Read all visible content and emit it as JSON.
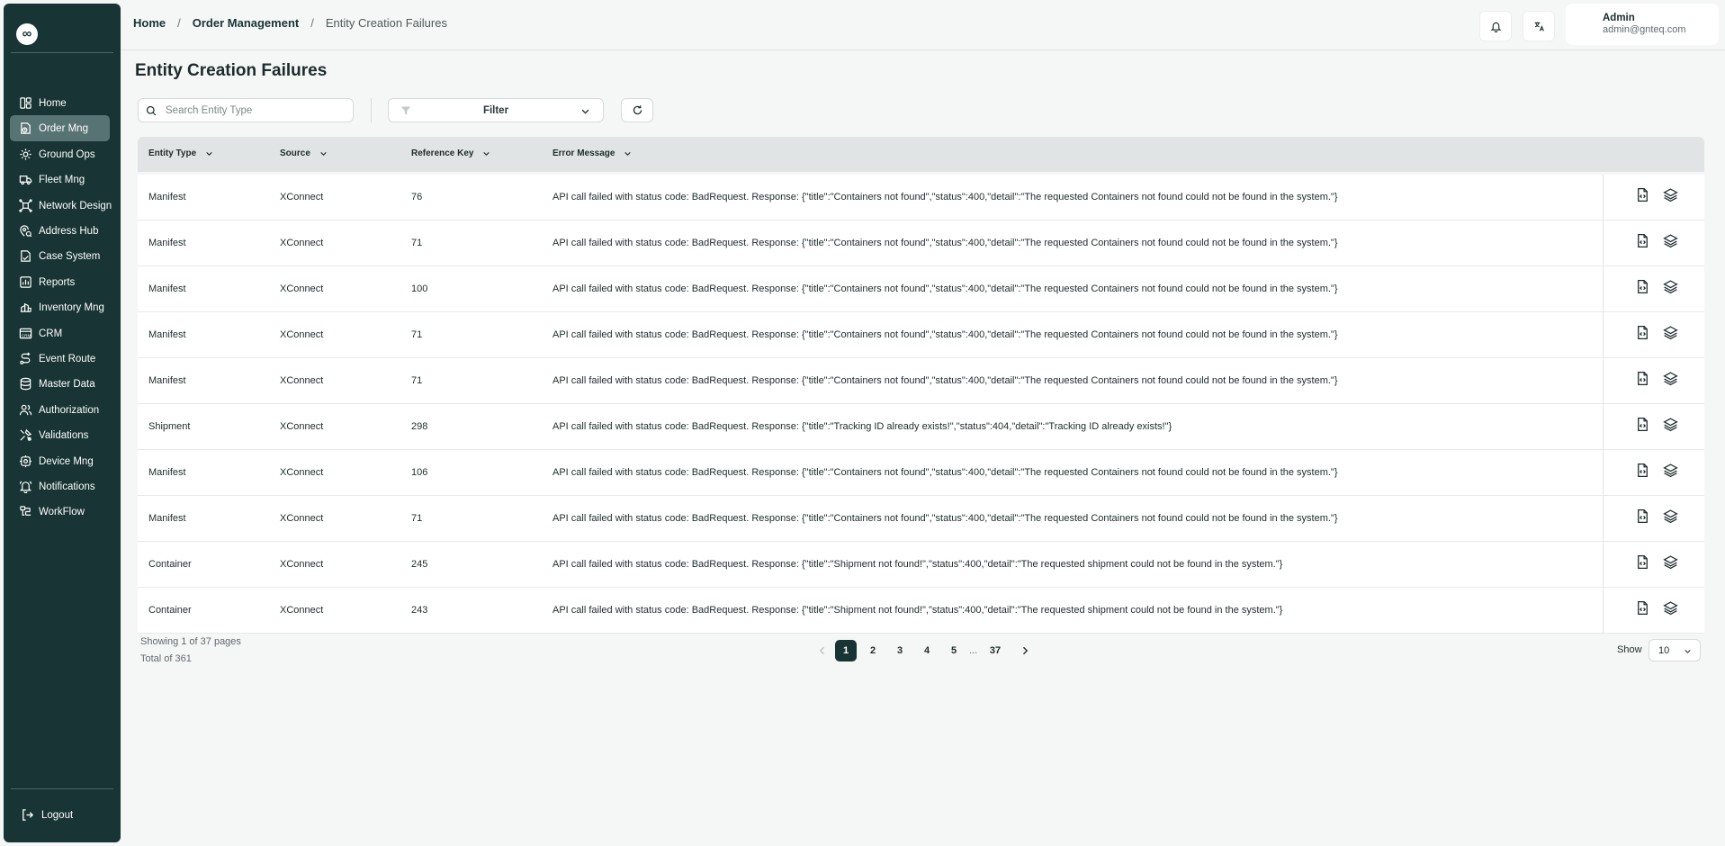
{
  "app": {
    "logo_glyph": "∞"
  },
  "sidebar": {
    "items": [
      {
        "label": "Home",
        "icon": "dashboard-icon"
      },
      {
        "label": "Order Mng",
        "icon": "order-icon",
        "active": true
      },
      {
        "label": "Ground Ops",
        "icon": "ground-ops-icon"
      },
      {
        "label": "Fleet Mng",
        "icon": "truck-icon"
      },
      {
        "label": "Network Design",
        "icon": "network-icon"
      },
      {
        "label": "Address Hub",
        "icon": "address-icon"
      },
      {
        "label": "Case System",
        "icon": "case-icon"
      },
      {
        "label": "Reports",
        "icon": "reports-icon"
      },
      {
        "label": "Inventory Mng",
        "icon": "inventory-icon"
      },
      {
        "label": "CRM",
        "icon": "crm-icon"
      },
      {
        "label": "Event Route",
        "icon": "route-icon"
      },
      {
        "label": "Master Data",
        "icon": "database-icon"
      },
      {
        "label": "Authorization",
        "icon": "users-icon"
      },
      {
        "label": "Validations",
        "icon": "validation-icon"
      },
      {
        "label": "Device Mng",
        "icon": "device-icon"
      },
      {
        "label": "Notifications",
        "icon": "bell-icon"
      },
      {
        "label": "WorkFlow",
        "icon": "workflow-icon"
      }
    ],
    "logout_label": "Logout"
  },
  "header": {
    "breadcrumb": {
      "home": "Home",
      "section": "Order Management",
      "current": "Entity Creation Failures"
    },
    "user": {
      "name": "Admin",
      "email": "admin@gnteq.com"
    }
  },
  "page": {
    "title": "Entity Creation Failures",
    "search_placeholder": "Search Entity Type",
    "filter_label": "Filter"
  },
  "table": {
    "columns": [
      "Entity Type",
      "Source",
      "Reference Key",
      "Error Message"
    ],
    "rows": [
      {
        "entity_type": "Manifest",
        "source": "XConnect",
        "reference_key": "76",
        "error_message": "API call failed with status code: BadRequest. Response: {\"title\":\"Containers not found\",\"status\":400,\"detail\":\"The requested Containers not found could not be found in the system.\"}"
      },
      {
        "entity_type": "Manifest",
        "source": "XConnect",
        "reference_key": "71",
        "error_message": "API call failed with status code: BadRequest. Response: {\"title\":\"Containers not found\",\"status\":400,\"detail\":\"The requested Containers not found could not be found in the system.\"}"
      },
      {
        "entity_type": "Manifest",
        "source": "XConnect",
        "reference_key": "100",
        "error_message": "API call failed with status code: BadRequest. Response: {\"title\":\"Containers not found\",\"status\":400,\"detail\":\"The requested Containers not found could not be found in the system.\"}"
      },
      {
        "entity_type": "Manifest",
        "source": "XConnect",
        "reference_key": "71",
        "error_message": "API call failed with status code: BadRequest. Response: {\"title\":\"Containers not found\",\"status\":400,\"detail\":\"The requested Containers not found could not be found in the system.\"}"
      },
      {
        "entity_type": "Manifest",
        "source": "XConnect",
        "reference_key": "71",
        "error_message": "API call failed with status code: BadRequest. Response: {\"title\":\"Containers not found\",\"status\":400,\"detail\":\"The requested Containers not found could not be found in the system.\"}"
      },
      {
        "entity_type": "Shipment",
        "source": "XConnect",
        "reference_key": "298",
        "error_message": "API call failed with status code: BadRequest. Response: {\"title\":\"Tracking ID already exists!\",\"status\":404,\"detail\":\"Tracking ID already exists!\"}"
      },
      {
        "entity_type": "Manifest",
        "source": "XConnect",
        "reference_key": "106",
        "error_message": "API call failed with status code: BadRequest. Response: {\"title\":\"Containers not found\",\"status\":400,\"detail\":\"The requested Containers not found could not be found in the system.\"}"
      },
      {
        "entity_type": "Manifest",
        "source": "XConnect",
        "reference_key": "71",
        "error_message": "API call failed with status code: BadRequest. Response: {\"title\":\"Containers not found\",\"status\":400,\"detail\":\"The requested Containers not found could not be found in the system.\"}"
      },
      {
        "entity_type": "Container",
        "source": "XConnect",
        "reference_key": "245",
        "error_message": "API call failed with status code: BadRequest. Response: {\"title\":\"Shipment not found!\",\"status\":400,\"detail\":\"The requested shipment could not be found in the system.\"}"
      },
      {
        "entity_type": "Container",
        "source": "XConnect",
        "reference_key": "243",
        "error_message": "API call failed with status code: BadRequest. Response: {\"title\":\"Shipment not found!\",\"status\":400,\"detail\":\"The requested shipment could not be found in the system.\"}"
      }
    ]
  },
  "pagination": {
    "showing_text": "Showing 1 of 37 pages",
    "total_text": "Total of 361",
    "pages": [
      "1",
      "2",
      "3",
      "4",
      "5"
    ],
    "ellipsis": "...",
    "last_page": "37",
    "current_page": "1",
    "show_label": "Show",
    "page_size": "10"
  },
  "colors": {
    "sidebar_bg": "#183434",
    "active_item": "#587373",
    "header_row": "#e1e4e4",
    "accent": "#183434"
  }
}
